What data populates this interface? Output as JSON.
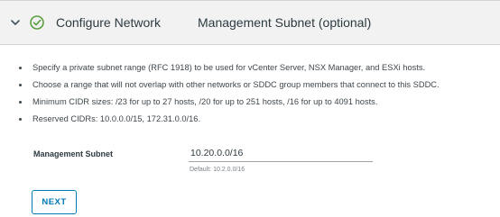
{
  "step": {
    "expand_icon": "chevron-down-icon",
    "status_icon": "check-circle-icon",
    "title": "Configure Network",
    "section_title": "Management Subnet (optional)"
  },
  "bullets": [
    "Specify a private subnet range (RFC 1918) to be used for vCenter Server, NSX Manager, and ESXi hosts.",
    "Choose a range that will not overlap with other networks or SDDC group members that connect to this SDDC.",
    "Minimum CIDR sizes: /23 for up to 27 hosts, /20 for up to 251 hosts, /16 for up to 4091 hosts.",
    "Reserved CIDRs: 10.0.0.0/15, 172.31.0.0/16."
  ],
  "management_subnet": {
    "label": "Management Subnet",
    "value": "10.20.0.0/16",
    "hint": "Default: 10.2.0.0/16"
  },
  "next_label": "NEXT",
  "colors": {
    "accent": "#0079b8",
    "success": "#5a9e3f",
    "header_bg": "#f2f2f2"
  }
}
